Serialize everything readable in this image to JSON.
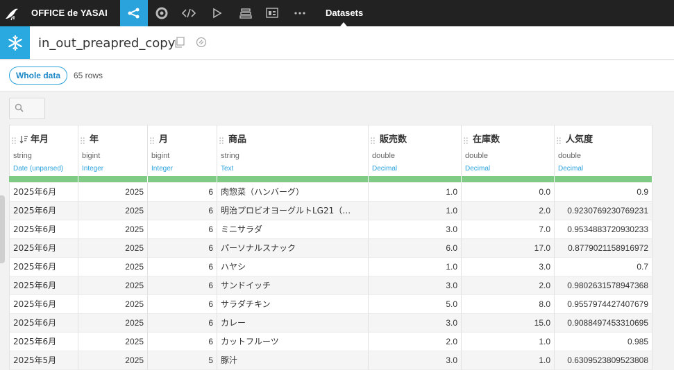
{
  "app": {
    "title": "OFFICE de YASAI",
    "current_section": "Datasets"
  },
  "dataset": {
    "name": "in_out_preapred_copy"
  },
  "view": {
    "sample_label": "Whole data",
    "row_count": "65 rows"
  },
  "columns": [
    {
      "name": "年月",
      "type": "string",
      "meaning": "Date (unparsed)",
      "sorted": true
    },
    {
      "name": "年",
      "type": "bigint",
      "meaning": "Integer"
    },
    {
      "name": "月",
      "type": "bigint",
      "meaning": "Integer"
    },
    {
      "name": "商品",
      "type": "string",
      "meaning": "Text"
    },
    {
      "name": "販売数",
      "type": "double",
      "meaning": "Decimal"
    },
    {
      "name": "在庫数",
      "type": "double",
      "meaning": "Decimal"
    },
    {
      "name": "人気度",
      "type": "double",
      "meaning": "Decimal"
    }
  ],
  "rows": [
    [
      "2025年6月",
      "2025",
      "6",
      "肉惣菜（ハンバーグ）",
      "1.0",
      "0.0",
      "0.9"
    ],
    [
      "2025年6月",
      "2025",
      "6",
      "明治プロビオヨーグルトLG21（…",
      "1.0",
      "2.0",
      "0.9230769230769231"
    ],
    [
      "2025年6月",
      "2025",
      "6",
      "ミニサラダ",
      "3.0",
      "7.0",
      "0.9534883720930233"
    ],
    [
      "2025年6月",
      "2025",
      "6",
      "パーソナルスナック",
      "6.0",
      "17.0",
      "0.8779021158916972"
    ],
    [
      "2025年6月",
      "2025",
      "6",
      "ハヤシ",
      "1.0",
      "3.0",
      "0.7"
    ],
    [
      "2025年6月",
      "2025",
      "6",
      "サンドイッチ",
      "3.0",
      "2.0",
      "0.9802631578947368"
    ],
    [
      "2025年6月",
      "2025",
      "6",
      "サラダチキン",
      "5.0",
      "8.0",
      "0.9557974427407679"
    ],
    [
      "2025年6月",
      "2025",
      "6",
      "カレー",
      "3.0",
      "15.0",
      "0.9088497453310695"
    ],
    [
      "2025年6月",
      "2025",
      "6",
      "カットフルーツ",
      "2.0",
      "1.0",
      "0.985"
    ],
    [
      "2025年5月",
      "2025",
      "5",
      "豚汁",
      "3.0",
      "1.0",
      "0.6309523809523808"
    ]
  ],
  "colors": {
    "accent": "#2aa2dc",
    "topbar": "#222222",
    "quality_ok": "#7fcb84"
  }
}
